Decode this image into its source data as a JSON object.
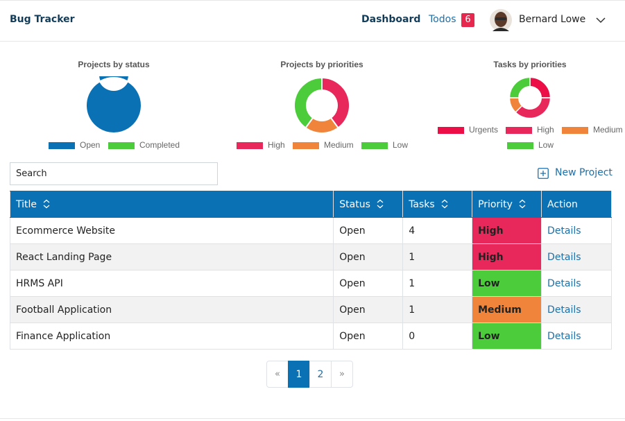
{
  "app": {
    "brand": "Bug Tracker"
  },
  "nav": {
    "dashboard_label": "Dashboard",
    "todos_label": "Todos",
    "todos_count": "6",
    "user_name": "Bernard Lowe"
  },
  "colors": {
    "primary": "#0a71b5",
    "high": "#e8285a",
    "urgent": "#ec0f47",
    "medium": "#f0843a",
    "low": "#4ccc3a",
    "badge": "#e6284f"
  },
  "chart_data": [
    {
      "type": "pie",
      "title": "Projects by status",
      "categories": [
        "Open",
        "Completed"
      ],
      "values": [
        5,
        0
      ],
      "colors": [
        "#0a71b5",
        "#4ccc3a"
      ],
      "legend": "bottom"
    },
    {
      "type": "pie",
      "title": "Projects by priorities",
      "categories": [
        "High",
        "Medium",
        "Low"
      ],
      "values": [
        2,
        1,
        2
      ],
      "colors": [
        "#e8285a",
        "#f0843a",
        "#4ccc3a"
      ],
      "legend": "bottom"
    },
    {
      "type": "pie",
      "title": "Tasks by priorities",
      "categories": [
        "Urgents",
        "High",
        "Medium",
        "Low"
      ],
      "values": [
        2,
        3,
        1,
        2
      ],
      "colors": [
        "#ec0f47",
        "#e8285a",
        "#f0843a",
        "#4ccc3a"
      ],
      "legend": "bottom"
    }
  ],
  "search": {
    "placeholder": "Search"
  },
  "toolbar": {
    "new_project_label": "New Project"
  },
  "table": {
    "columns": [
      "Title",
      "Status",
      "Tasks",
      "Priority",
      "Action"
    ],
    "rows": [
      {
        "title": "Ecommerce Website",
        "status": "Open",
        "tasks": "4",
        "priority": "High",
        "action": "Details"
      },
      {
        "title": "React Landing Page",
        "status": "Open",
        "tasks": "1",
        "priority": "High",
        "action": "Details"
      },
      {
        "title": "HRMS API",
        "status": "Open",
        "tasks": "1",
        "priority": "Low",
        "action": "Details"
      },
      {
        "title": "Football Application",
        "status": "Open",
        "tasks": "1",
        "priority": "Medium",
        "action": "Details"
      },
      {
        "title": "Finance Application",
        "status": "Open",
        "tasks": "0",
        "priority": "Low",
        "action": "Details"
      }
    ]
  },
  "pagination": {
    "prev": "«",
    "pages": [
      "1",
      "2"
    ],
    "current": "1",
    "next": "»"
  }
}
